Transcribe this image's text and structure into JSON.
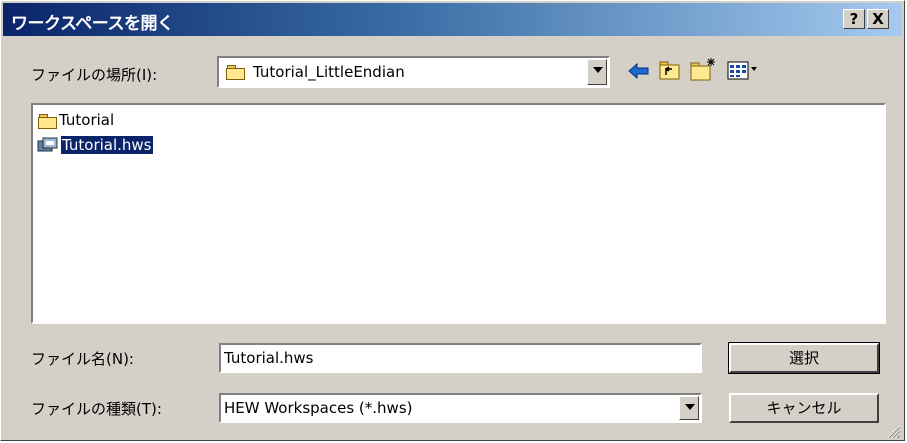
{
  "window": {
    "title": "ワークスペースを開く",
    "help_label": "?",
    "close_label": "X"
  },
  "location": {
    "label": "ファイルの場所(I):",
    "value": "Tutorial_LittleEndian"
  },
  "toolbar": {
    "icons": [
      "back-arrow-icon",
      "up-folder-icon",
      "new-folder-icon",
      "view-menu-icon"
    ]
  },
  "file_list": {
    "items": [
      {
        "name": "Tutorial",
        "icon": "folder-icon",
        "selected": false
      },
      {
        "name": "Tutorial.hws",
        "icon": "workspace-file-icon",
        "selected": true
      }
    ]
  },
  "filename": {
    "label": "ファイル名(N):",
    "value": "Tutorial.hws"
  },
  "filetype": {
    "label": "ファイルの種類(T):",
    "value": "HEW Workspaces (*.hws)"
  },
  "buttons": {
    "select": "選択",
    "cancel": "キャンセル"
  },
  "colors": {
    "titlebar_start": "#0a246a",
    "titlebar_end": "#a6caf0",
    "dialog_bg": "#d4d0c8",
    "selection": "#0a246a"
  }
}
